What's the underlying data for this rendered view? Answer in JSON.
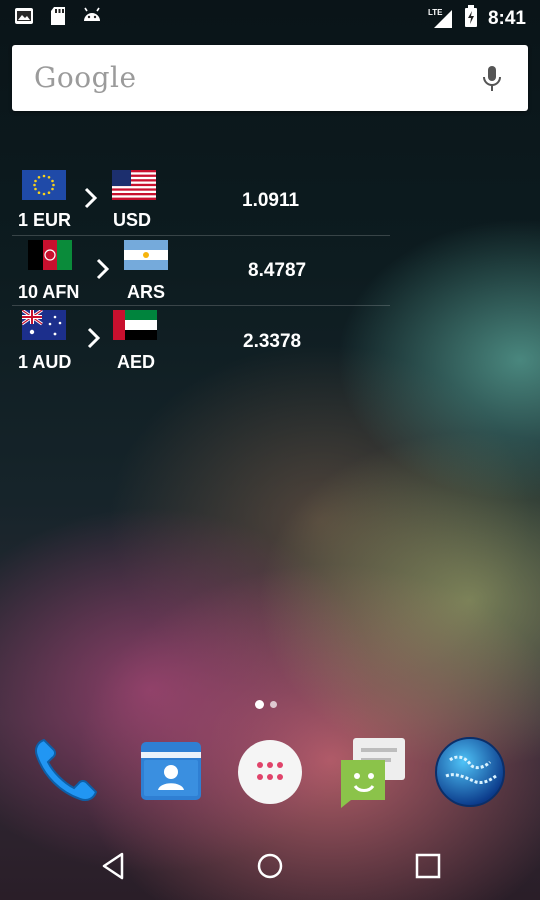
{
  "status_bar": {
    "time": "8:41",
    "network_label": "LTE",
    "left_icons": [
      "gallery-icon",
      "sd-card-icon",
      "android-icon"
    ],
    "right_icons": [
      "signal-icon",
      "battery-charging-icon"
    ]
  },
  "search": {
    "logo_text": "Google",
    "mic_icon": "mic-icon"
  },
  "currency_widget": {
    "rows": [
      {
        "from_code": "1 EUR",
        "from_flag": "eu-flag-icon",
        "to_code": "USD",
        "to_flag": "us-flag-icon",
        "rate": "1.0911"
      },
      {
        "from_code": "10 AFN",
        "from_flag": "af-flag-icon",
        "to_code": "ARS",
        "to_flag": "ar-flag-icon",
        "rate": "8.4787"
      },
      {
        "from_code": "1 AUD",
        "from_flag": "au-flag-icon",
        "to_code": "AED",
        "to_flag": "ae-flag-icon",
        "rate": "2.3378"
      }
    ]
  },
  "dock": {
    "apps": [
      "phone-icon",
      "contacts-icon",
      "app-drawer-icon",
      "messaging-icon",
      "browser-icon"
    ]
  },
  "nav_bar": {
    "buttons": [
      "back-icon",
      "home-icon",
      "recents-icon"
    ]
  },
  "colors": {
    "search_bg": "#ffffff",
    "logo_gray": "#9b9b9b",
    "phone_blue": "#1e88e5",
    "contacts_blue": "#2f7fd3",
    "messaging_green": "#8bc34a"
  }
}
